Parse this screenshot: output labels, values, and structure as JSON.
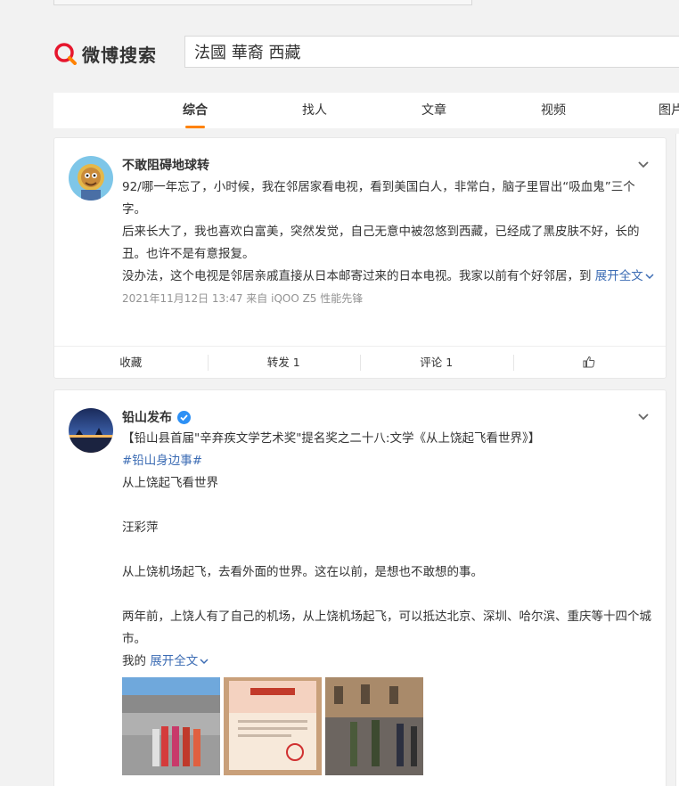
{
  "header": {
    "logo_text": "微博搜索",
    "search_value": "法國 華裔 西藏"
  },
  "tabs": [
    {
      "label": "综合",
      "active": true
    },
    {
      "label": "找人",
      "active": false
    },
    {
      "label": "文章",
      "active": false
    },
    {
      "label": "视频",
      "active": false
    },
    {
      "label": "图片",
      "active": false
    }
  ],
  "posts": [
    {
      "author": "不敢阻碍地球转",
      "paragraphs": [
        "92/哪一年忘了，小时候，我在邻居家看电视，看到美国白人，非常白，脑子里冒出“吸血鬼”三个字。",
        "后来长大了，我也喜欢白富美，突然发觉，自己无意中被忽悠到西藏，已经成了黑皮肤不好，长的丑。也许不是有意报复。",
        "没办法，这个电视是邻居亲戚直接从日本邮寄过来的日本电视。我家以前有个好邻居，到"
      ],
      "expand_label": "展开全文",
      "meta": "2021年11月12日 13:47  来自 iQOO Z5 性能先锋",
      "actions": {
        "collect": "收藏",
        "repost": "转发 1",
        "comment": "评论 1"
      }
    },
    {
      "author": "铅山发布",
      "title_line": "【铅山县首届\"辛弃疾文学艺术奖\"提名奖之二十八:文学《从上饶起飞看世界》】",
      "hashtag": "#铅山身边事#",
      "lines": [
        "从上饶起飞看世界",
        "汪彩萍",
        "从上饶机场起飞，去看外面的世界。这在以前，是想也不敢想的事。",
        "两年前，上饶人有了自己的机场，从上饶机场起飞，可以抵达北京、深圳、哈尔滨、重庆等十四个城市。"
      ],
      "last_prefix": "我的",
      "expand_label": "展开全文"
    }
  ],
  "colors": {
    "accent": "#ff8200",
    "link": "#eb7350",
    "verify": "#2d90f5"
  }
}
